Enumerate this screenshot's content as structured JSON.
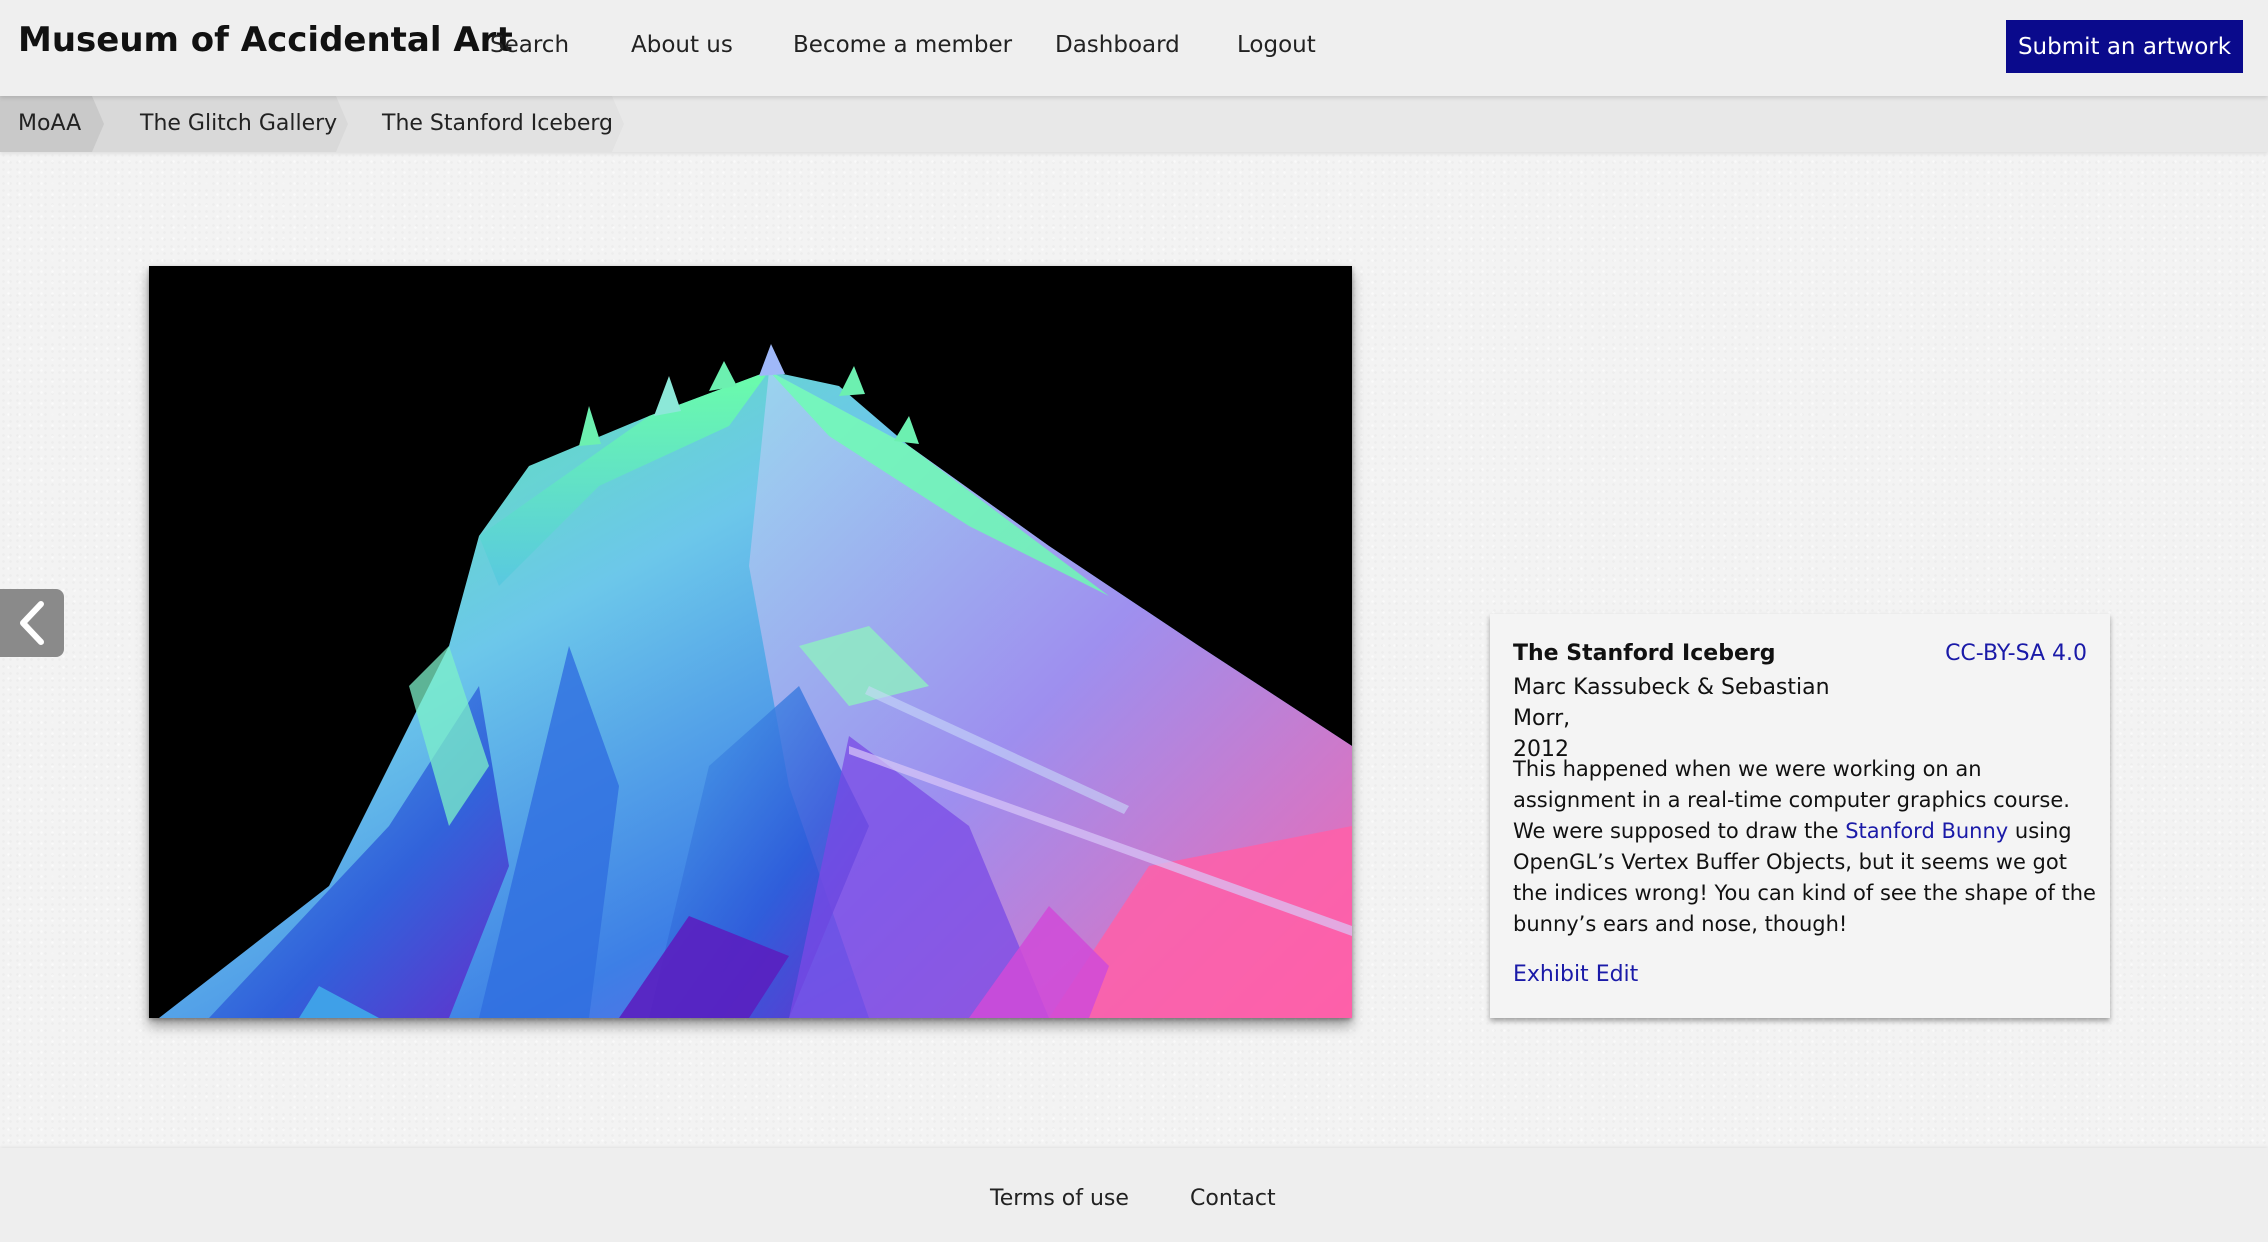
{
  "header": {
    "site_title": "Museum of Accidental Art",
    "nav": [
      "Search",
      "About us",
      "Become a member",
      "Dashboard",
      "Logout"
    ],
    "submit_label": "Submit an artwork",
    "accent_color": "#0a0a8c"
  },
  "breadcrumb": [
    "MoAA",
    "The Glitch Gallery",
    "The Stanford Iceberg"
  ],
  "navigation": {
    "prev_icon": "chevron-left-icon"
  },
  "artwork": {
    "title": "The Stanford Iceberg",
    "artists": "Marc Kassubeck & Sebastian Morr,",
    "year": "2012",
    "license": "CC-BY-SA 4.0",
    "description_before": "This happened when we were working on an assignment in a real-time computer graphics course. We were supposed to draw the ",
    "description_link": "Stanford Bunny",
    "description_after": " using OpenGL’s Vertex Buffer Objects, but it seems we got the indices wrong! You can kind of see the shape of the bunny’s ears and nose, though!",
    "exhibit_label": "Exhibit",
    "edit_label": "Edit"
  },
  "footer": {
    "terms_label": "Terms of use",
    "contact_label": "Contact"
  }
}
